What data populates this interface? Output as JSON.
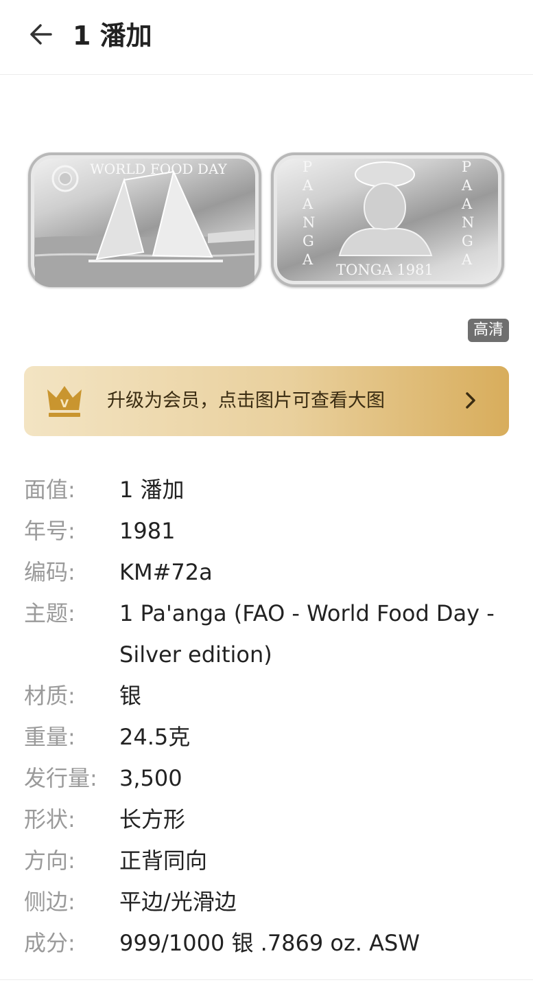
{
  "header": {
    "title": "1 潘加",
    "back_icon": "arrow-left-icon"
  },
  "coin": {
    "obverse_text": "WORLD FOOD DAY",
    "reverse_text_bottom": "TONGA 1981",
    "reverse_text_side": "PA'ANGA",
    "hd_badge": "高清"
  },
  "vip_banner": {
    "icon": "crown-icon",
    "letter": "V",
    "text": "升级为会员，点击图片可查看大图",
    "arrow_icon": "chevron-right-icon",
    "colors": {
      "start": "#f3e4c3",
      "end": "#d8ad5c"
    }
  },
  "details": [
    {
      "label": "面值:",
      "value": "1 潘加"
    },
    {
      "label": "年号:",
      "value": "1981"
    },
    {
      "label": "编码:",
      "value": "KM#72a"
    },
    {
      "label": "主题:",
      "value": "1 Pa'anga (FAO - World Food Day - Silver edition)"
    },
    {
      "label": "材质:",
      "value": "银"
    },
    {
      "label": "重量:",
      "value": "24.5克"
    },
    {
      "label": "发行量:",
      "value": "3,500"
    },
    {
      "label": "形状:",
      "value": "长方形"
    },
    {
      "label": "方向:",
      "value": "正背同向"
    },
    {
      "label": "侧边:",
      "value": "平边/光滑边"
    },
    {
      "label": "成分:",
      "value": "999/1000 银 .7869 oz. ASW"
    }
  ]
}
